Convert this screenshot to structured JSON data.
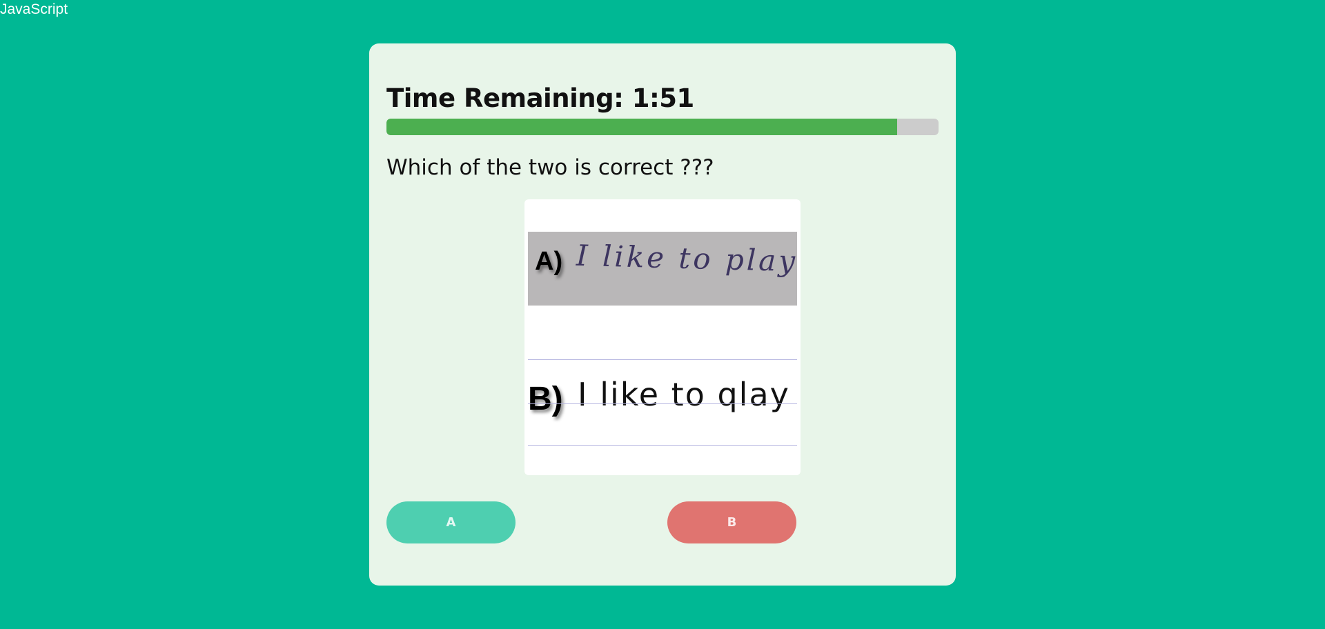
{
  "corner": {
    "text": "JavaScript"
  },
  "quiz": {
    "timer_label": "Time Remaining: 1:51",
    "progress_fraction": 0.925,
    "question": "Which of the two is correct ???",
    "image": {
      "option_a_label": "A)",
      "option_a_text": "I like to play",
      "option_b_label": "B)",
      "option_b_text": "I like to qlay"
    },
    "buttons": {
      "a_label": "A",
      "b_label": "B"
    }
  },
  "colors": {
    "background": "#00b894",
    "card": "#e8f5e9",
    "progress_fill": "#4caf50",
    "progress_track": "#cccccc",
    "button_a": "#4ecfb0",
    "button_b": "#e07470"
  }
}
